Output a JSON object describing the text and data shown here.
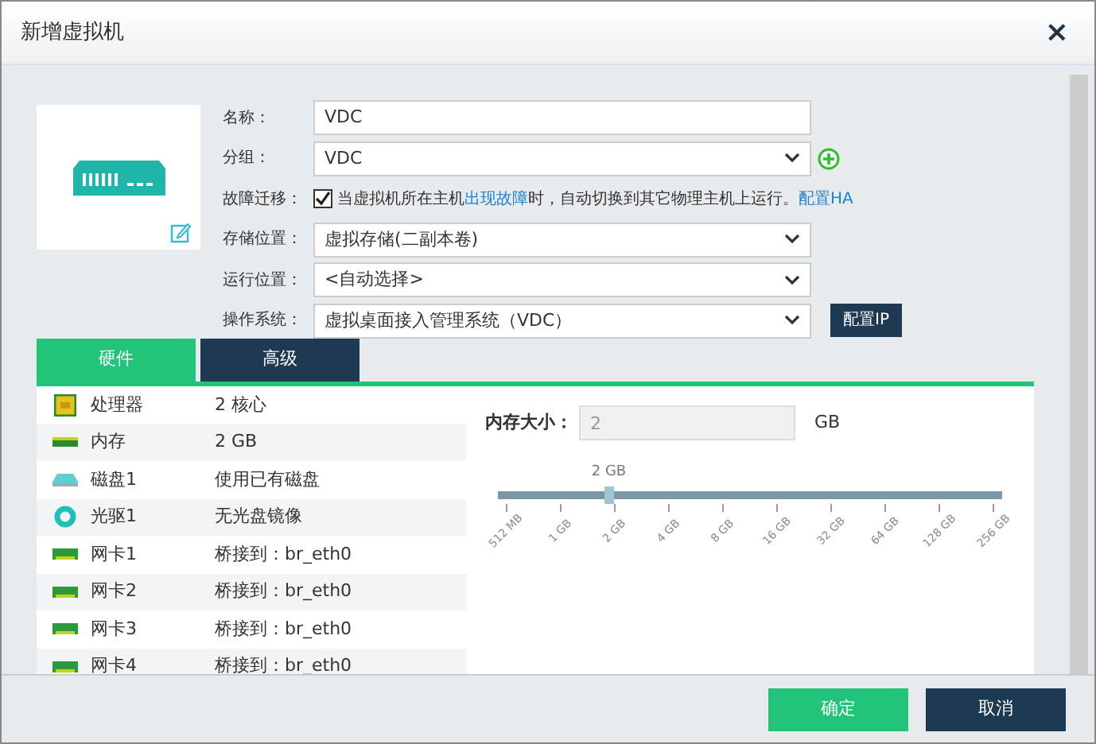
{
  "dialog": {
    "title": "新增虚拟机",
    "close": "×"
  },
  "form": [
    {
      "kind": "text",
      "label": "名称：",
      "value": "VDC"
    },
    {
      "kind": "select",
      "label": "分组：",
      "value": "VDC",
      "add": true
    },
    {
      "kind": "checkbox",
      "label": "故障迁移：",
      "checked": true,
      "before": "当虚拟机所在主机",
      "link": "出现故障",
      "after": "时，自动切换到其它物理主机上运行。",
      "action": "配置HA"
    },
    {
      "kind": "select",
      "label": "存储位置：",
      "value": "虚拟存储(二副本卷)"
    },
    {
      "kind": "select",
      "label": "运行位置：",
      "value": "<自动选择>"
    },
    {
      "kind": "select",
      "label": "操作系统：",
      "value": "虚拟桌面接入管理系统（VDC）",
      "button": "配置IP"
    }
  ],
  "tabs": [
    {
      "label": "硬件",
      "selected": true
    },
    {
      "label": "高级",
      "selected": false
    }
  ],
  "hardware": [
    {
      "kind": "cpu",
      "name": "处理器",
      "value": "2 核心"
    },
    {
      "kind": "memory",
      "name": "内存",
      "value": "2 GB"
    },
    {
      "kind": "disk",
      "name": "磁盘1",
      "value": "使用已有磁盘"
    },
    {
      "kind": "cdrom",
      "name": "光驱1",
      "value": "无光盘镜像"
    },
    {
      "kind": "nic",
      "name": "网卡1",
      "value": "桥接到：br_eth0"
    },
    {
      "kind": "nic",
      "name": "网卡2",
      "value": "桥接到：br_eth0"
    },
    {
      "kind": "nic",
      "name": "网卡3",
      "value": "桥接到：br_eth0"
    },
    {
      "kind": "nic",
      "name": "网卡4",
      "value": "桥接到：br_eth0"
    }
  ],
  "memory": {
    "label": "内存大小：",
    "placeholder": "2",
    "unit": "GB",
    "slider_label": "2 GB",
    "level": 0.22,
    "ticks": [
      "512 MB",
      "1 GB",
      "2 GB",
      "4 GB",
      "8 GB",
      "16 GB",
      "32 GB",
      "64 GB",
      "128 GB",
      "256 GB"
    ]
  },
  "buttons": [
    "确定",
    "取消"
  ]
}
